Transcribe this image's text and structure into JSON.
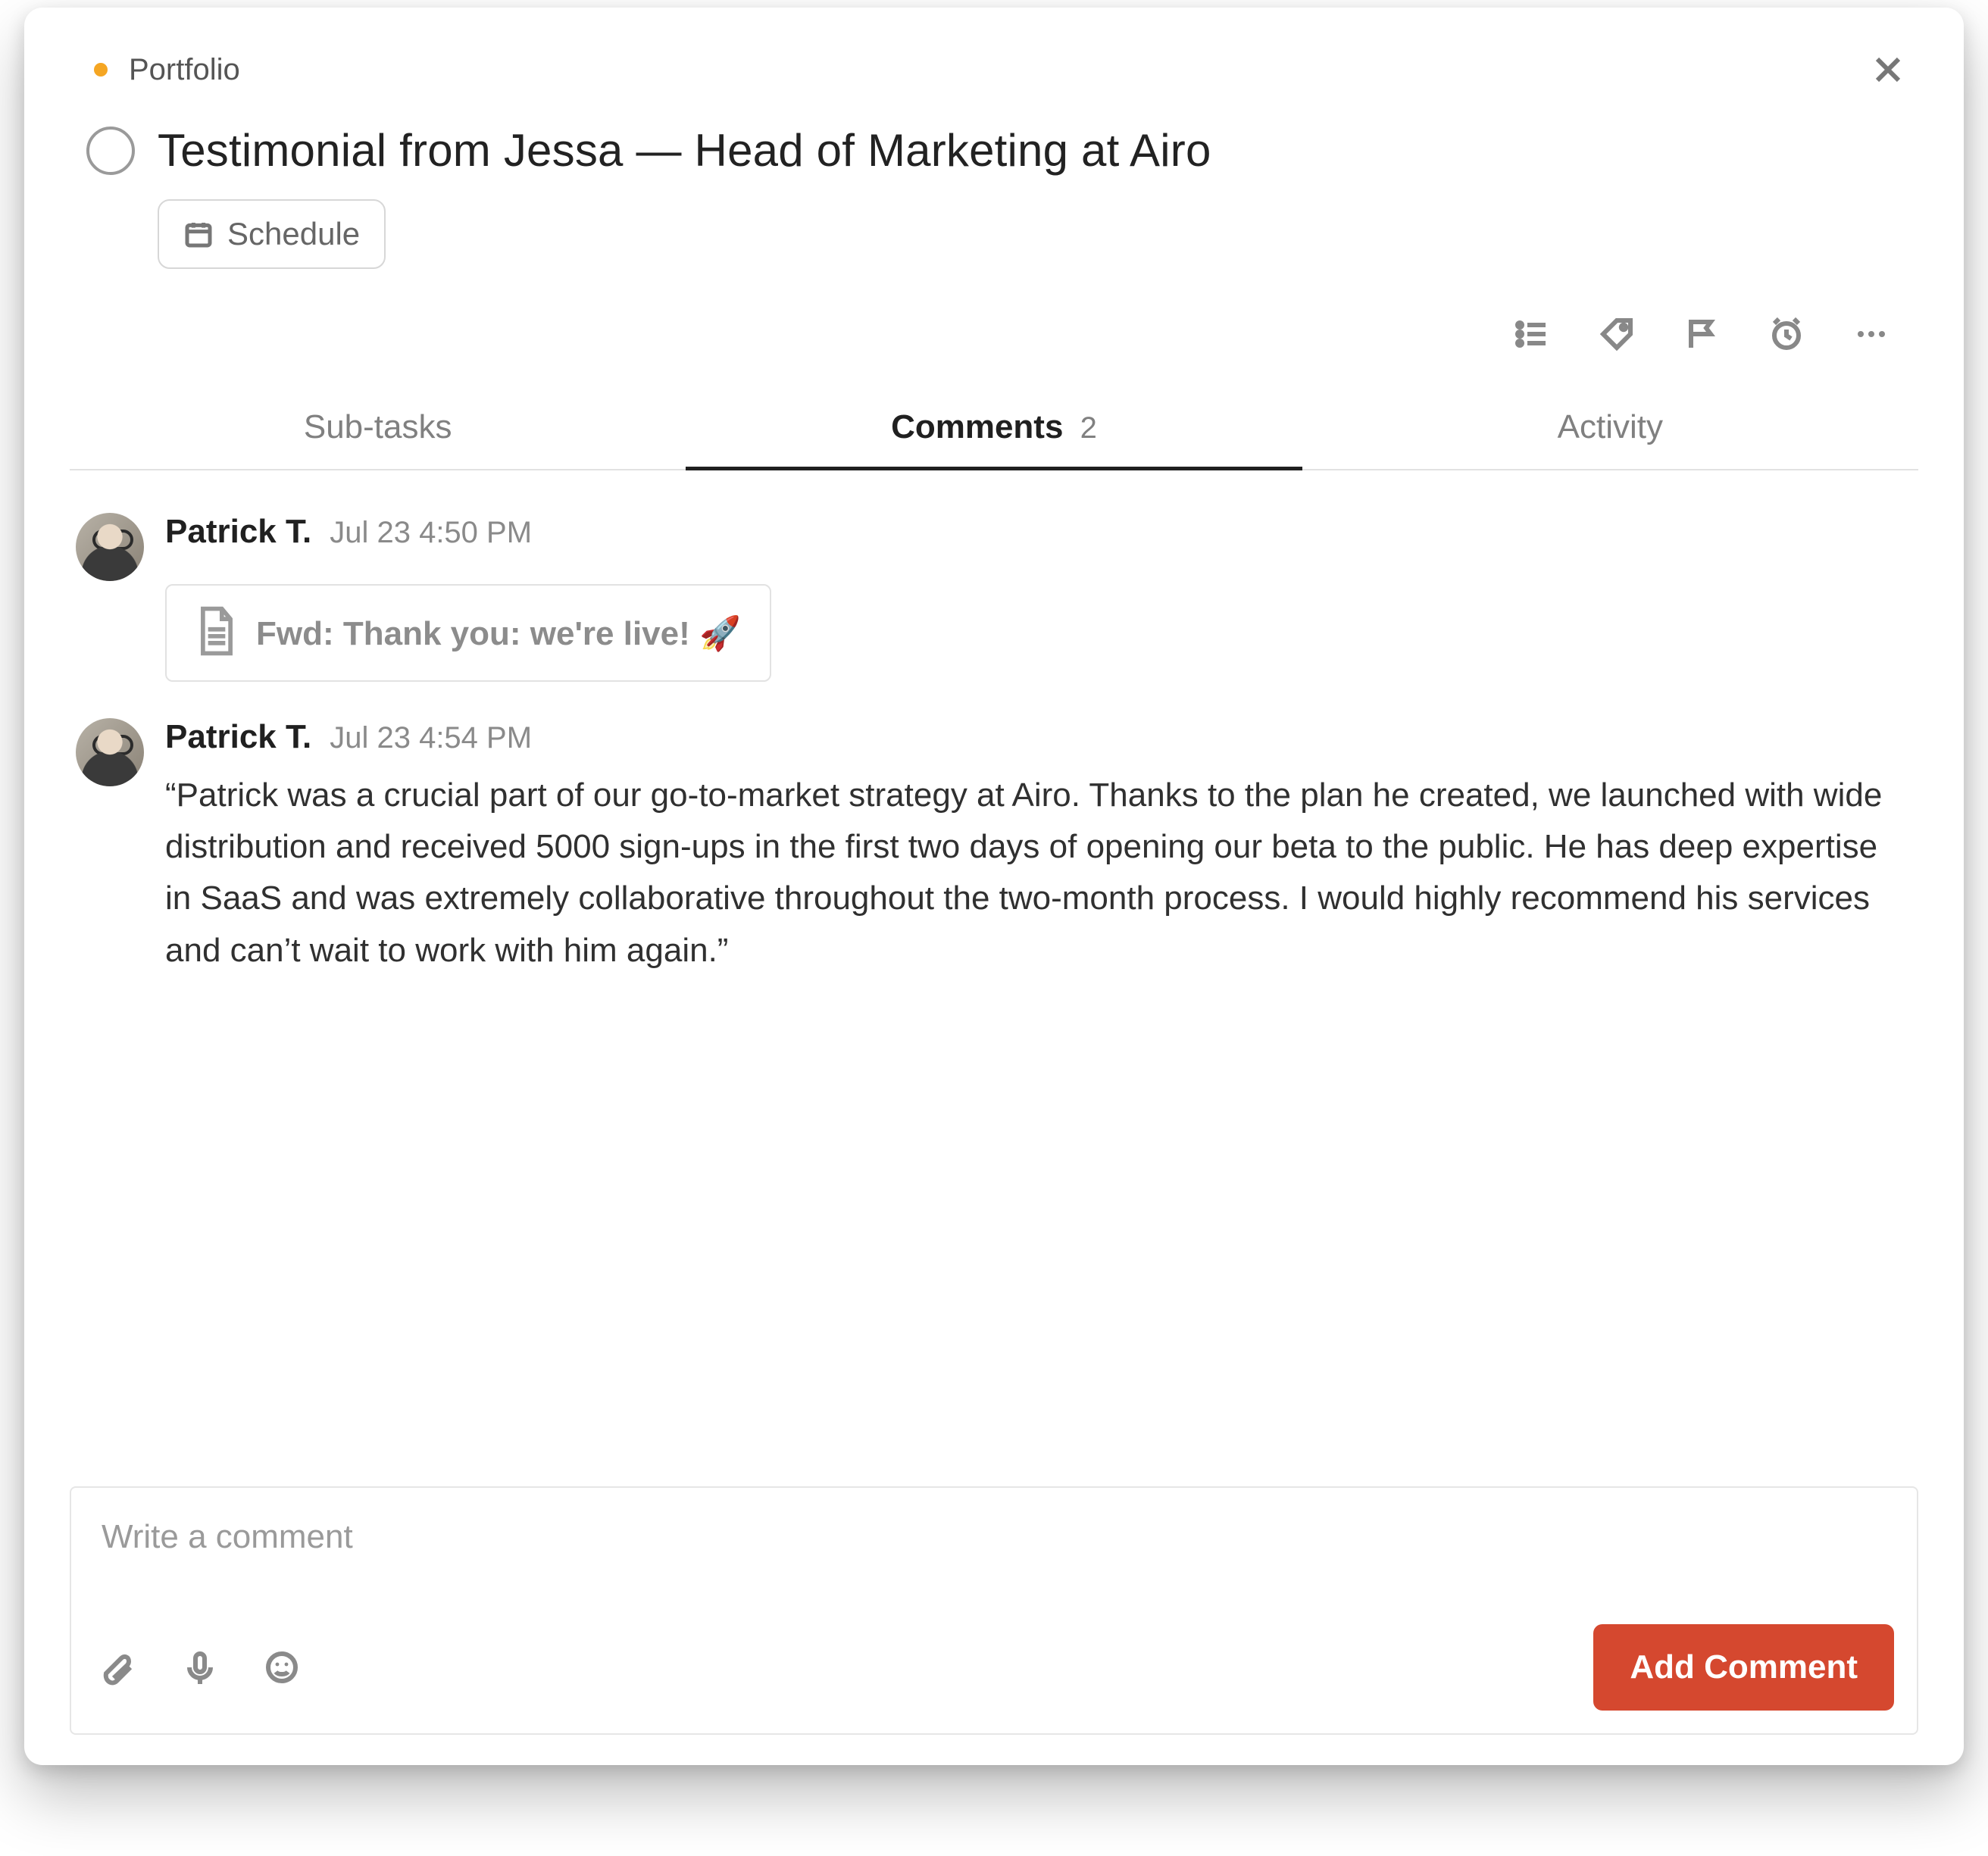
{
  "header": {
    "project_label": "Portfolio",
    "project_color": "#f5a623"
  },
  "task": {
    "title": "Testimonial from Jessa — Head of Marketing at Airo",
    "schedule_label": "Schedule"
  },
  "toolbar_icons": {
    "list": "list-icon",
    "tag": "tag-icon",
    "flag": "flag-icon",
    "reminder": "alarm-clock-icon",
    "more": "more-icon"
  },
  "tabs": {
    "subtasks": {
      "label": "Sub-tasks"
    },
    "comments": {
      "label": "Comments",
      "count": "2"
    },
    "activity": {
      "label": "Activity"
    },
    "active": "comments"
  },
  "comments": [
    {
      "author": "Patrick T.",
      "timestamp": "Jul 23 4:50 PM",
      "attachment": {
        "title": "Fwd: Thank you: we're live! 🚀"
      }
    },
    {
      "author": "Patrick T.",
      "timestamp": "Jul 23 4:54 PM",
      "text": "“Patrick was a crucial part of our go-to-market strategy at Airo. Thanks to the plan he created, we launched with wide distribution and received 5000 sign-ups in the first two days of opening our beta to the public. He has deep expertise in SaaS and was extremely collaborative throughout the two-month process. I would highly recommend his services and can’t wait to work with him again.”"
    }
  ],
  "composer": {
    "placeholder": "Write a comment",
    "submit_label": "Add Comment"
  }
}
